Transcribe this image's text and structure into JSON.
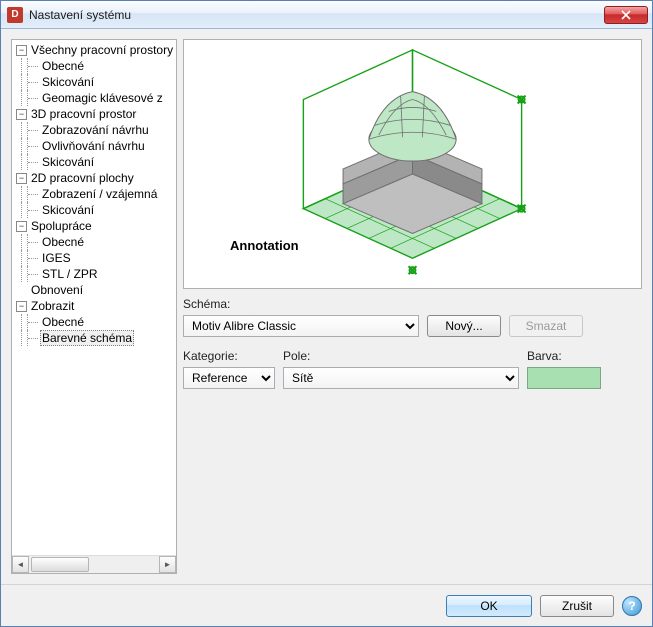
{
  "window": {
    "title": "Nastavení systému"
  },
  "tree": {
    "n0": "Všechny pracovní prostory",
    "n0_0": "Obecné",
    "n0_1": "Skicování",
    "n0_2": "Geomagic klávesové z",
    "n1": "3D pracovní prostor",
    "n1_0": "Zobrazování návrhu",
    "n1_1": "Ovlivňování návrhu",
    "n1_2": "Skicování",
    "n2": "2D pracovní plochy",
    "n2_0": "Zobrazení / vzájemná",
    "n2_1": "Skicování",
    "n3": "Spolupráce",
    "n3_0": "Obecné",
    "n3_1": "IGES",
    "n3_2": "STL / ZPR",
    "n4": "Obnovení",
    "n5": "Zobrazit",
    "n5_0": "Obecné",
    "n5_1": "Barevné schéma"
  },
  "preview": {
    "annotation": "Annotation"
  },
  "form": {
    "scheme_label": "Schéma:",
    "scheme_value": "Motiv Alibre Classic",
    "new_btn": "Nový...",
    "delete_btn": "Smazat",
    "category_label": "Kategorie:",
    "category_value": "Reference",
    "field_label": "Pole:",
    "field_value": "Sítě",
    "color_label": "Barva:",
    "color_value": "#a9e0b1"
  },
  "footer": {
    "ok": "OK",
    "cancel": "Zrušit"
  }
}
